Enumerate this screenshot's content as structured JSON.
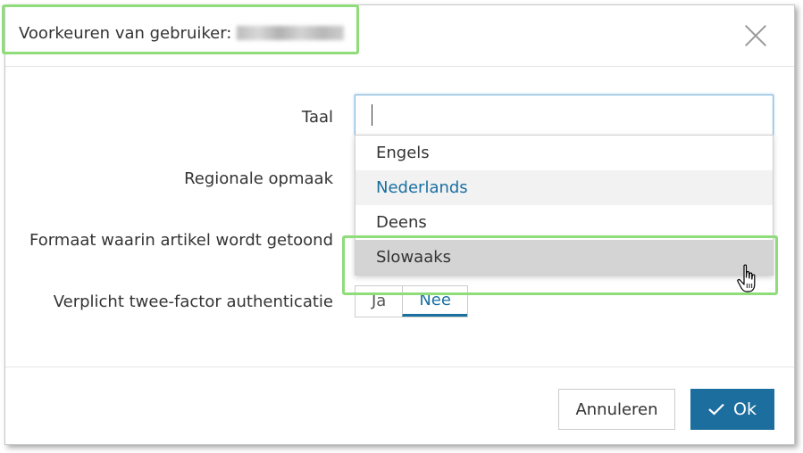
{
  "dialog": {
    "title": "Voorkeuren van gebruiker:",
    "close_icon": "close-icon"
  },
  "form": {
    "taal_label": "Taal",
    "taal_value": "",
    "regionale_label": "Regionale opmaak",
    "formaat_label": "Formaat waarin artikel wordt getoond",
    "twee_factor_label": "Verplicht twee-factor authenticatie",
    "toggle": {
      "options": [
        "Ja",
        "Nee"
      ],
      "selected": "Nee"
    }
  },
  "dropdown": {
    "items": [
      "Engels",
      "Nederlands",
      "Deens",
      "Slowaaks"
    ],
    "hovered": "Nederlands",
    "selected": "Slowaaks"
  },
  "footer": {
    "cancel_label": "Annuleren",
    "ok_label": "Ok"
  },
  "colors": {
    "accent": "#1c6e9e",
    "highlight": "#8edc7a"
  }
}
